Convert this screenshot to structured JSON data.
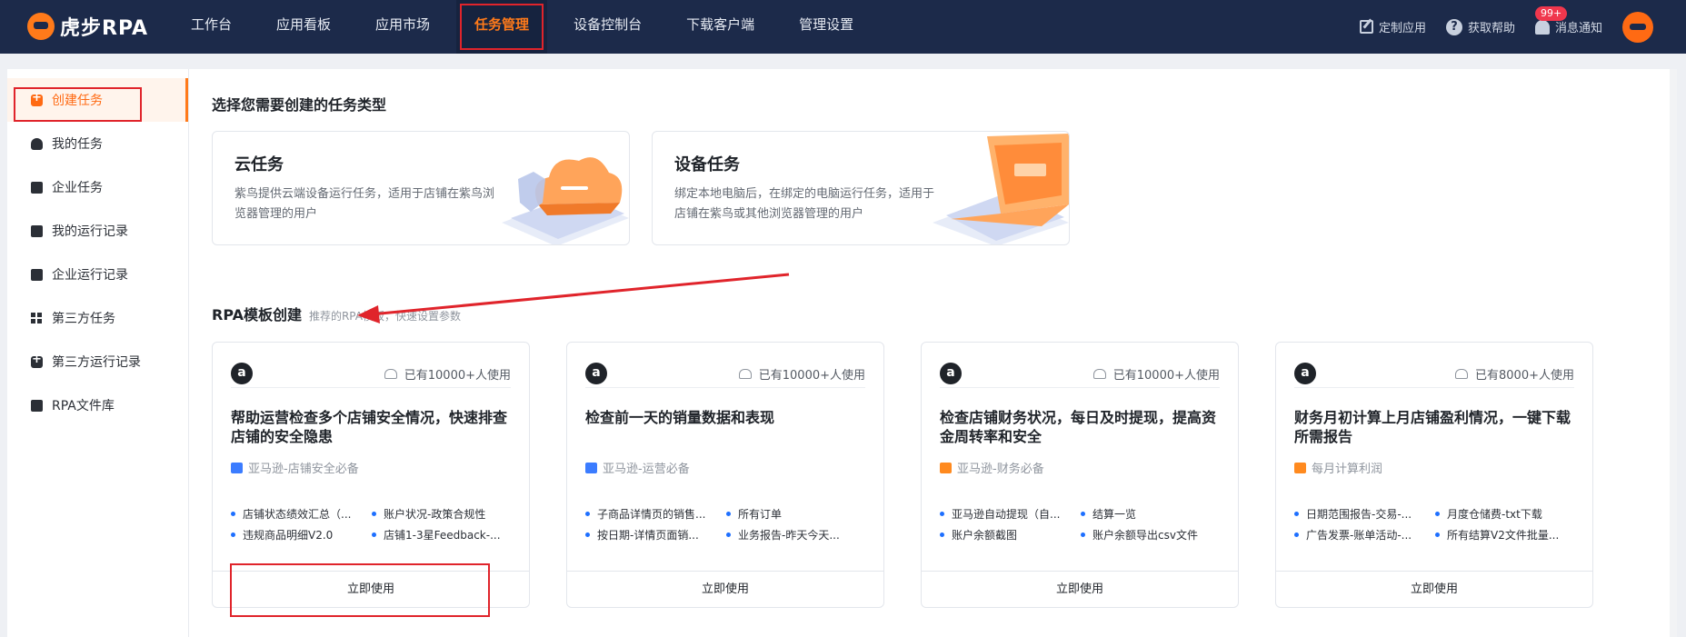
{
  "brand": {
    "name": "虎步RPA"
  },
  "nav": {
    "items": [
      "工作台",
      "应用看板",
      "应用市场",
      "任务管理",
      "设备控制台",
      "下载客户端",
      "管理设置"
    ]
  },
  "top_right": {
    "custom_app": "定制应用",
    "help": "获取帮助",
    "notify": "消息通知",
    "badge": "99+"
  },
  "sidebar": {
    "items": [
      "创建任务",
      "我的任务",
      "企业任务",
      "我的运行记录",
      "企业运行记录",
      "第三方任务",
      "第三方运行记录",
      "RPA文件库"
    ]
  },
  "main": {
    "select_title": "选择您需要创建的任务类型",
    "cloud_task": {
      "title": "云任务",
      "desc": "紫鸟提供云端设备运行任务，适用于店铺在紫鸟浏览器管理的用户"
    },
    "device_task": {
      "title": "设备任务",
      "desc": "绑定本地电脑后，在绑定的电脑运行任务，适用于店铺在紫鸟或其他浏览器管理的用户"
    },
    "rpa_title": "RPA模板创建",
    "rpa_note": "推荐的RPA模板，快速设置参数"
  },
  "templates": [
    {
      "usage": "已有10000+人使用",
      "title": "帮助运营检查多个店铺安全情况，快速排查店铺的安全隐患",
      "category": "亚马逊-店铺安全必备",
      "cat_color": "#3b7cff",
      "features": [
        "店铺状态绩效汇总（...",
        "账户状况-政策合规性",
        "违规商品明细V2.0",
        "店铺1-3星Feedback-..."
      ],
      "button": "立即使用"
    },
    {
      "usage": "已有10000+人使用",
      "title": "检查前一天的销量数据和表现",
      "category": "亚马逊-运营必备",
      "cat_color": "#3b7cff",
      "features": [
        "子商品详情页的销售...",
        "所有订单",
        "按日期-详情页面销...",
        "业务报告-昨天今天..."
      ],
      "button": "立即使用"
    },
    {
      "usage": "已有10000+人使用",
      "title": "检查店铺财务状况，每日及时提现，提高资金周转率和安全",
      "category": "亚马逊-财务必备",
      "cat_color": "#ff8a1f",
      "features": [
        "亚马逊自动提现（自...",
        "结算一览",
        "账户余额截图",
        "账户余额导出csv文件"
      ],
      "button": "立即使用"
    },
    {
      "usage": "已有8000+人使用",
      "title": "财务月初计算上月店铺盈利情况，一键下载所需报告",
      "category": "每月计算利润",
      "cat_color": "#ff8a1f",
      "features": [
        "日期范围报告-交易-...",
        "月度仓储费-txt下载",
        "广告发票-账单活动-...",
        "所有结算V2文件批量..."
      ],
      "button": "立即使用"
    }
  ],
  "colors": {
    "nav_bg": "#1c2a4a",
    "accent": "#ff6a13",
    "highlight": "#e0242b",
    "bullet": "#1e6fff"
  }
}
